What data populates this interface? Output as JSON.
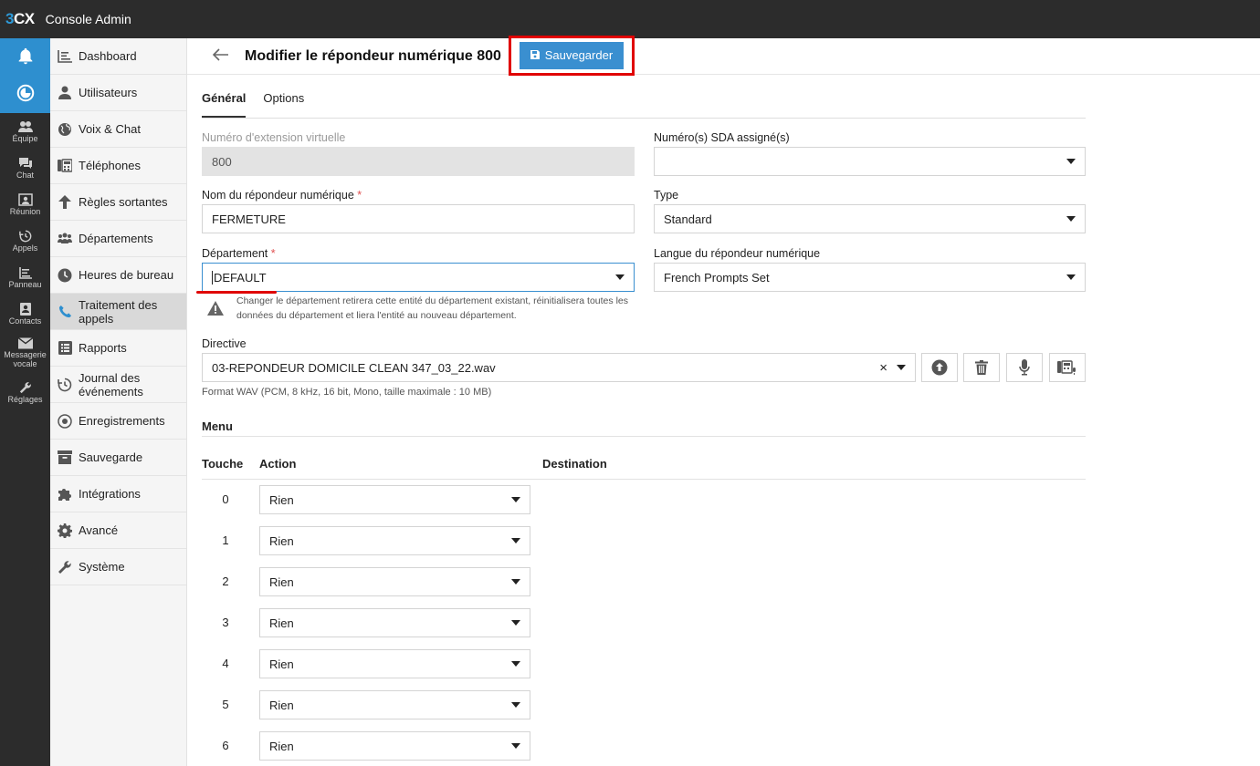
{
  "app": {
    "logo": "3CX",
    "title": "Console Admin"
  },
  "rail": [
    {
      "name": "rail-team",
      "label": "Équipe"
    },
    {
      "name": "rail-chat",
      "label": "Chat"
    },
    {
      "name": "rail-meeting",
      "label": "Réunion"
    },
    {
      "name": "rail-calls",
      "label": "Appels"
    },
    {
      "name": "rail-panel",
      "label": "Panneau"
    },
    {
      "name": "rail-contacts",
      "label": "Contacts"
    },
    {
      "name": "rail-voicemail",
      "label": "Messagerie vocale"
    },
    {
      "name": "rail-settings",
      "label": "Réglages"
    }
  ],
  "sidebar": {
    "items": [
      {
        "label": "Dashboard"
      },
      {
        "label": "Utilisateurs"
      },
      {
        "label": "Voix & Chat"
      },
      {
        "label": "Téléphones"
      },
      {
        "label": "Règles sortantes"
      },
      {
        "label": "Départements"
      },
      {
        "label": "Heures de bureau"
      },
      {
        "label": "Traitement des appels"
      },
      {
        "label": "Rapports"
      },
      {
        "label": "Journal des événements"
      },
      {
        "label": "Enregistrements"
      },
      {
        "label": "Sauvegarde"
      },
      {
        "label": "Intégrations"
      },
      {
        "label": "Avancé"
      },
      {
        "label": "Système"
      }
    ]
  },
  "header": {
    "title": "Modifier le répondeur numérique 800",
    "save_label": "Sauvegarder"
  },
  "tabs": [
    {
      "label": "Général"
    },
    {
      "label": "Options"
    }
  ],
  "form": {
    "ext_label": "Numéro d'extension virtuelle",
    "ext_value": "800",
    "did_label": "Numéro(s) SDA assigné(s)",
    "did_value": "",
    "name_label": "Nom du répondeur numérique",
    "name_value": "FERMETURE",
    "type_label": "Type",
    "type_value": "Standard",
    "dept_label": "Département",
    "dept_value": "DEFAULT",
    "lang_label": "Langue du répondeur numérique",
    "lang_value": "French Prompts Set",
    "warning": "Changer le département retirera cette entité du département existant, réinitialisera toutes les données du département et liera l'entité au nouveau département.",
    "prompt_label": "Directive",
    "prompt_value": "03-REPONDEUR DOMICILE CLEAN 347_03_22.wav",
    "prompt_hint": "Format WAV (PCM, 8 kHz, 16 bit, Mono, taille maximale : 10 MB)",
    "required_mark": "*"
  },
  "menu": {
    "title": "Menu",
    "col_key": "Touche",
    "col_action": "Action",
    "col_dest": "Destination",
    "rows": [
      {
        "key": "0",
        "action": "Rien"
      },
      {
        "key": "1",
        "action": "Rien"
      },
      {
        "key": "2",
        "action": "Rien"
      },
      {
        "key": "3",
        "action": "Rien"
      },
      {
        "key": "4",
        "action": "Rien"
      },
      {
        "key": "5",
        "action": "Rien"
      },
      {
        "key": "6",
        "action": "Rien"
      }
    ]
  },
  "colors": {
    "accent": "#3a8fd0",
    "highlight": "#e00000",
    "rail_bg": "#2c2c2c"
  }
}
